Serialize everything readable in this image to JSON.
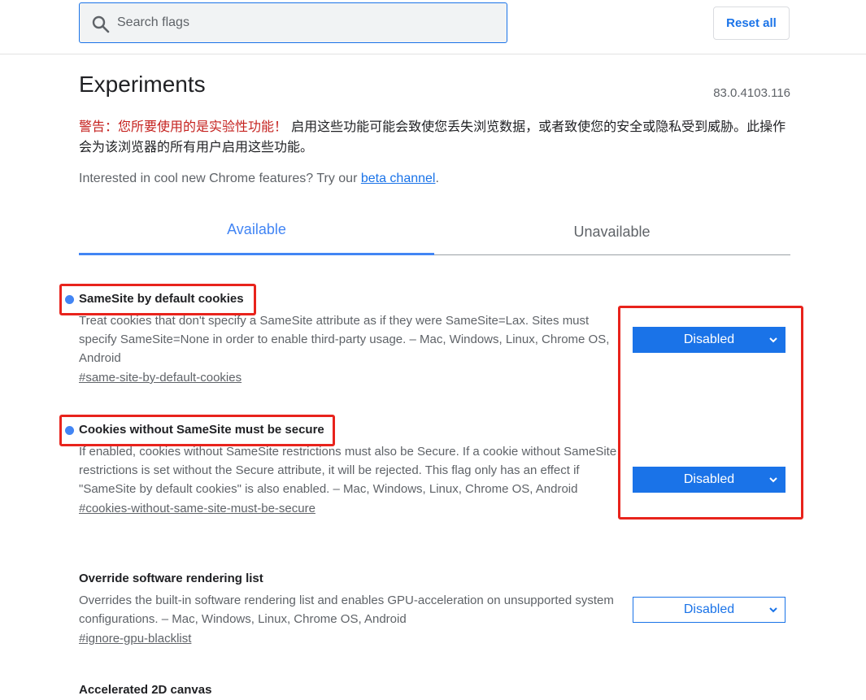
{
  "search": {
    "placeholder": "Search flags"
  },
  "toolbar": {
    "reset_label": "Reset all"
  },
  "page": {
    "title": "Experiments",
    "version": "83.0.4103.116",
    "warning_red": "警告：您所要使用的是实验性功能！",
    "warning_body": " 启用这些功能可能会致使您丢失浏览数据，或者致使您的安全或隐私受到威胁。此操作会为该浏览器的所有用户启用这些功能。",
    "promo_text": "Interested in cool new Chrome features? Try our ",
    "promo_link": "beta channel",
    "promo_end": "."
  },
  "tabs": [
    {
      "label": "Available"
    },
    {
      "label": "Unavailable"
    }
  ],
  "experiments": [
    {
      "title": "SameSite by default cookies",
      "description": "Treat cookies that don't specify a SameSite attribute as if they were SameSite=Lax. Sites must specify SameSite=None in order to enable third-party usage. – Mac, Windows, Linux, Chrome OS, Android",
      "link": "#same-site-by-default-cookies",
      "value": "Disabled"
    },
    {
      "title": "Cookies without SameSite must be secure",
      "description": "If enabled, cookies without SameSite restrictions must also be Secure. If a cookie without SameSite restrictions is set without the Secure attribute, it will be rejected. This flag only has an effect if \"SameSite by default cookies\" is also enabled. – Mac, Windows, Linux, Chrome OS, Android",
      "link": "#cookies-without-same-site-must-be-secure",
      "value": "Disabled"
    },
    {
      "title": "Override software rendering list",
      "description": "Overrides the built-in software rendering list and enables GPU-acceleration on unsupported system configurations. – Mac, Windows, Linux, Chrome OS, Android",
      "link": "#ignore-gpu-blacklist",
      "value": "Disabled"
    },
    {
      "title": "Accelerated 2D canvas"
    }
  ],
  "colors": {
    "accent": "#1a73e8",
    "tab_active": "#4285f4",
    "warning": "#c5221f",
    "annotation": "#e8231c"
  }
}
